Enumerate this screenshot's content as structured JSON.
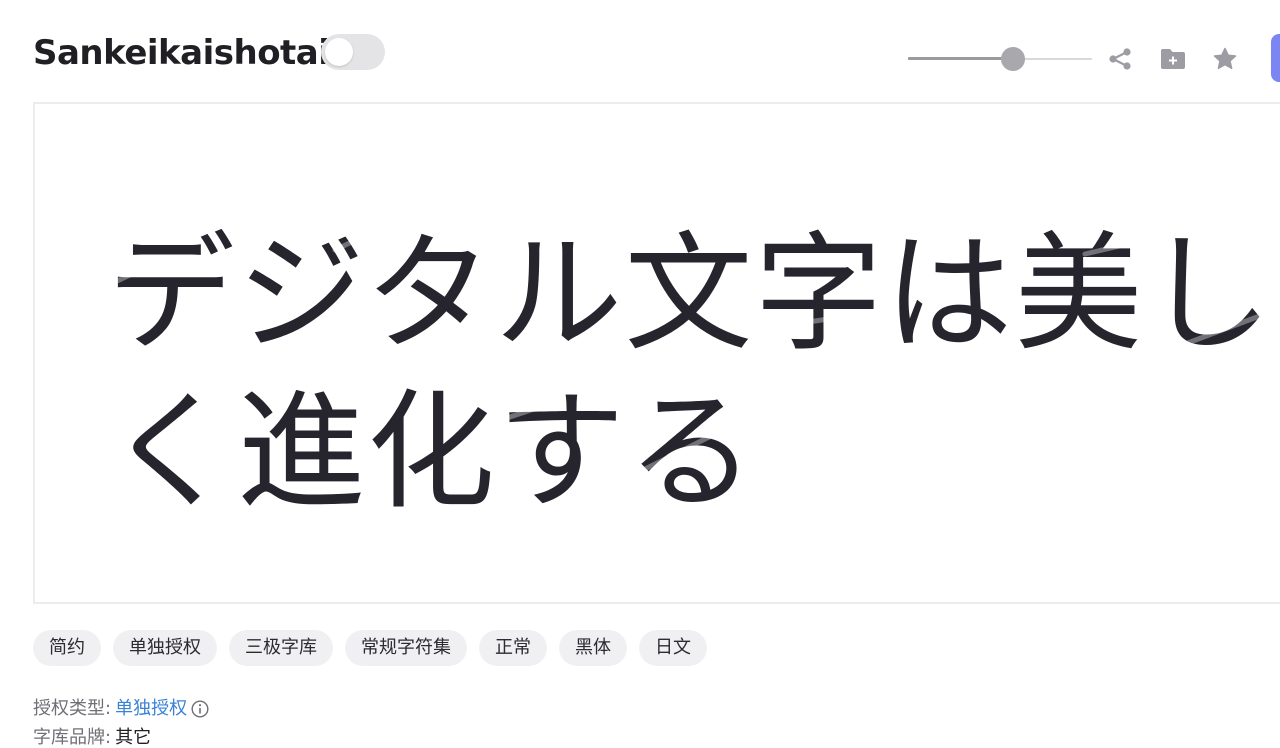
{
  "header": {
    "title": "Sankeikaishotai",
    "toggle_on": false,
    "size_slider_value": 0.57
  },
  "toolbar": {
    "icons": [
      "share-icon",
      "add-to-folder-icon",
      "favorite-icon"
    ],
    "accent_color": "#7b86f2"
  },
  "preview": {
    "sample_text": "デジタル文字は美しく進化する",
    "text_color": "#26252e"
  },
  "tags": [
    "简约",
    "单独授权",
    "三极字库",
    "常规字符集",
    "正常",
    "黑体",
    "日文"
  ],
  "info": {
    "license_label": "授权类型:",
    "license_value": "单独授权",
    "brand_label": "字库品牌:",
    "brand_value": "其它",
    "link_color": "#3b82d6"
  }
}
